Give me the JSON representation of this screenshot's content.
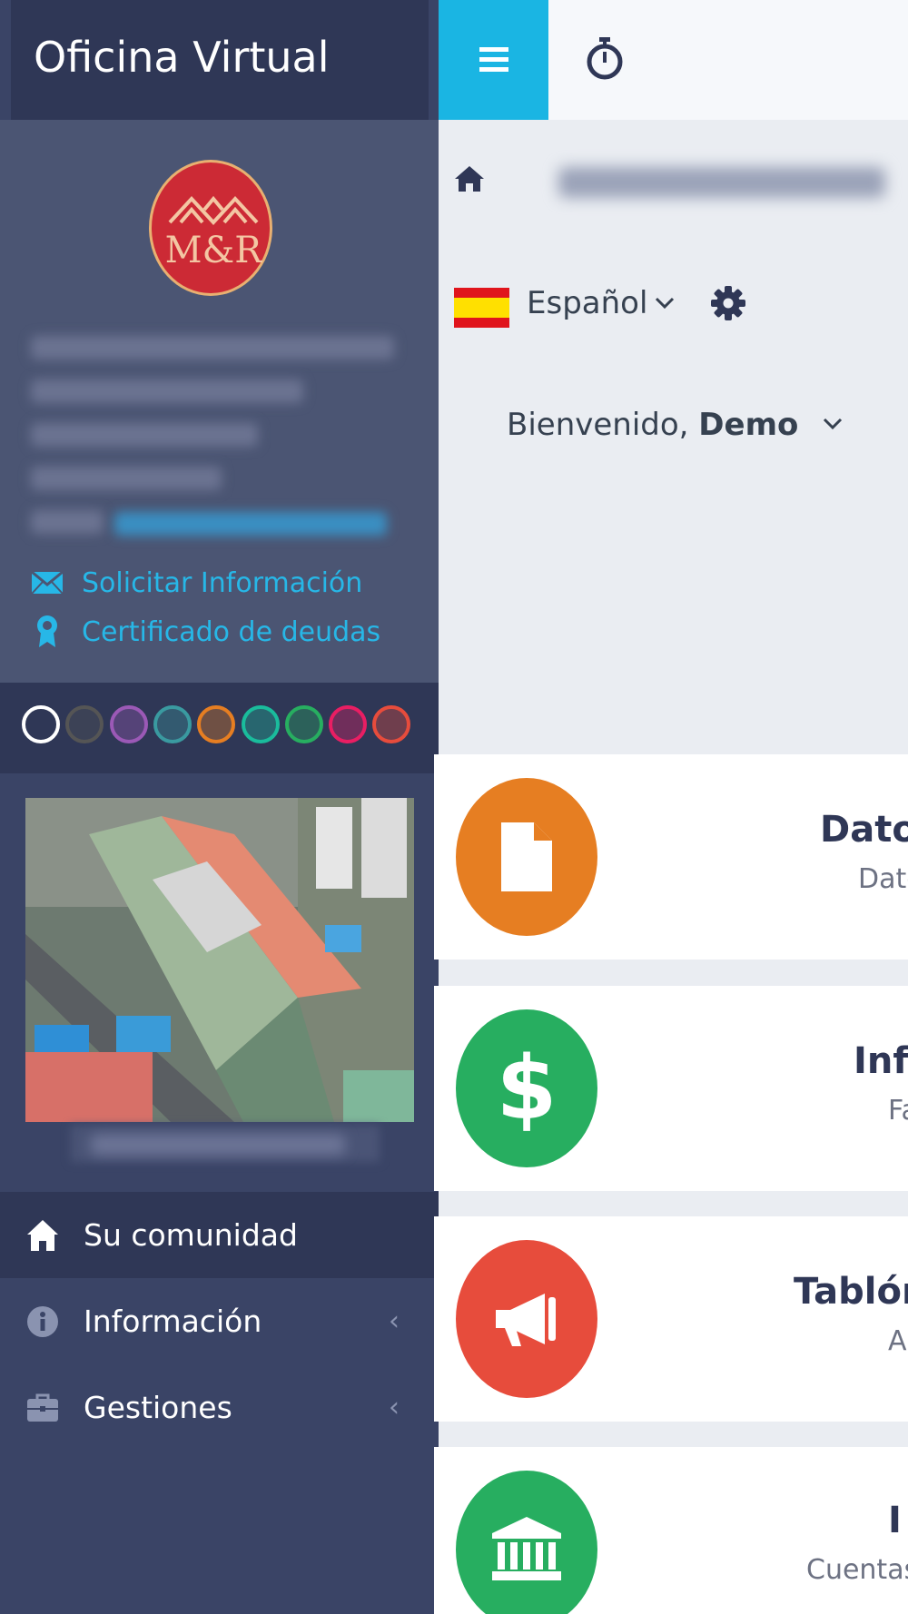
{
  "app": {
    "title": "Oficina Virtual"
  },
  "profile": {
    "links": [
      {
        "label": "Solicitar Información",
        "icon": "envelope-icon"
      },
      {
        "label": "Certificado de deudas",
        "icon": "certificate-icon"
      }
    ]
  },
  "theme": {
    "swatches": [
      "#ffffff",
      "#555555",
      "#9b59b6",
      "#3a9aa0",
      "#e67e22",
      "#1abc9c",
      "#27ae60",
      "#e91e63",
      "#e74c3c"
    ]
  },
  "nav": {
    "items": [
      {
        "label": "Su comunidad",
        "icon": "home-icon",
        "active": true
      },
      {
        "label": "Información",
        "icon": "info-icon"
      },
      {
        "label": "Gestiones",
        "icon": "briefcase-icon"
      }
    ]
  },
  "header": {
    "language": "Español",
    "welcome_prefix": "Bienvenido,",
    "welcome_user": "Demo"
  },
  "cards": [
    {
      "title": "Datos",
      "subtitle": "Dato",
      "color": "#e67e22",
      "icon": "file-icon"
    },
    {
      "title": "Info",
      "subtitle": "Fa",
      "color": "#27ae60",
      "icon": "dollar-icon"
    },
    {
      "title": "Tablón",
      "subtitle": "A",
      "color": "#e74c3c",
      "icon": "megaphone-icon"
    },
    {
      "title": "I",
      "subtitle": "Cuentas",
      "color": "#27ae60",
      "icon": "bank-icon"
    }
  ],
  "colors": {
    "accent": "#1ab5e3",
    "sidebar": "#3a4466",
    "link": "#27b7e7"
  }
}
